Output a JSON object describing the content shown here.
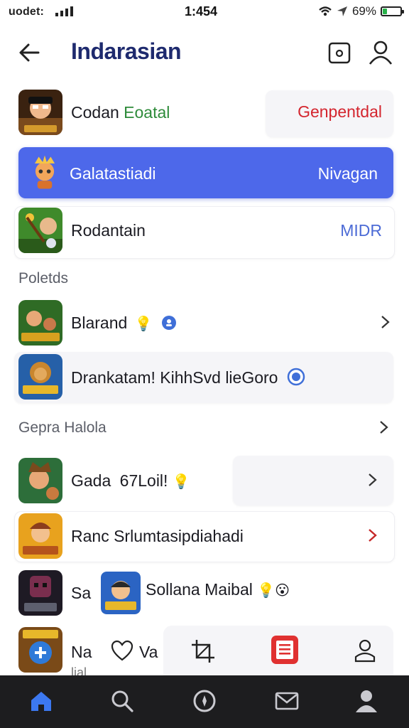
{
  "status": {
    "carrier": "uodet:",
    "time": "1:454",
    "battery": "69%",
    "battery_level": 0.25
  },
  "header": {
    "title": "Indarasian",
    "back_icon": "back-arrow-icon",
    "camera_icon": "camera-icon",
    "user_icon": "user-icon"
  },
  "rows": {
    "r1": {
      "label_a": "Codan",
      "label_b": "Eoatal",
      "action": "Genpentdal",
      "action_color": "#d4252e"
    },
    "r2": {
      "label": "Galatastiadi",
      "action": "Nivagan",
      "bg_color": "#4d68ea"
    },
    "r3": {
      "label": "Rodantain",
      "action": "MIDR",
      "action_color": "#4c6bd6"
    }
  },
  "section1": {
    "title": "Poletds"
  },
  "rows2": {
    "r4": {
      "label": "Blarand",
      "emoji": "💡"
    },
    "r5": {
      "label": "Drankatam! KihhSvd lieGoro"
    }
  },
  "section2": {
    "title": "Gepra Halola"
  },
  "rows3": {
    "r6": {
      "label_a": "Gada",
      "label_b": "67Loil!",
      "emoji": "💡"
    },
    "r7": {
      "label": "Ranc Srlumtasipdiahadi"
    },
    "r8": {
      "label": "Sa",
      "label2": "Sollana Maibal",
      "emoji": "💡😮"
    },
    "r9": {
      "label": "Na",
      "sub": "lial",
      "label2": "Va"
    }
  },
  "nav": {
    "items": [
      "home-icon",
      "search-icon",
      "compass-icon",
      "mail-icon",
      "profile-icon"
    ],
    "active": "home-icon",
    "active_color": "#3c78f0"
  }
}
